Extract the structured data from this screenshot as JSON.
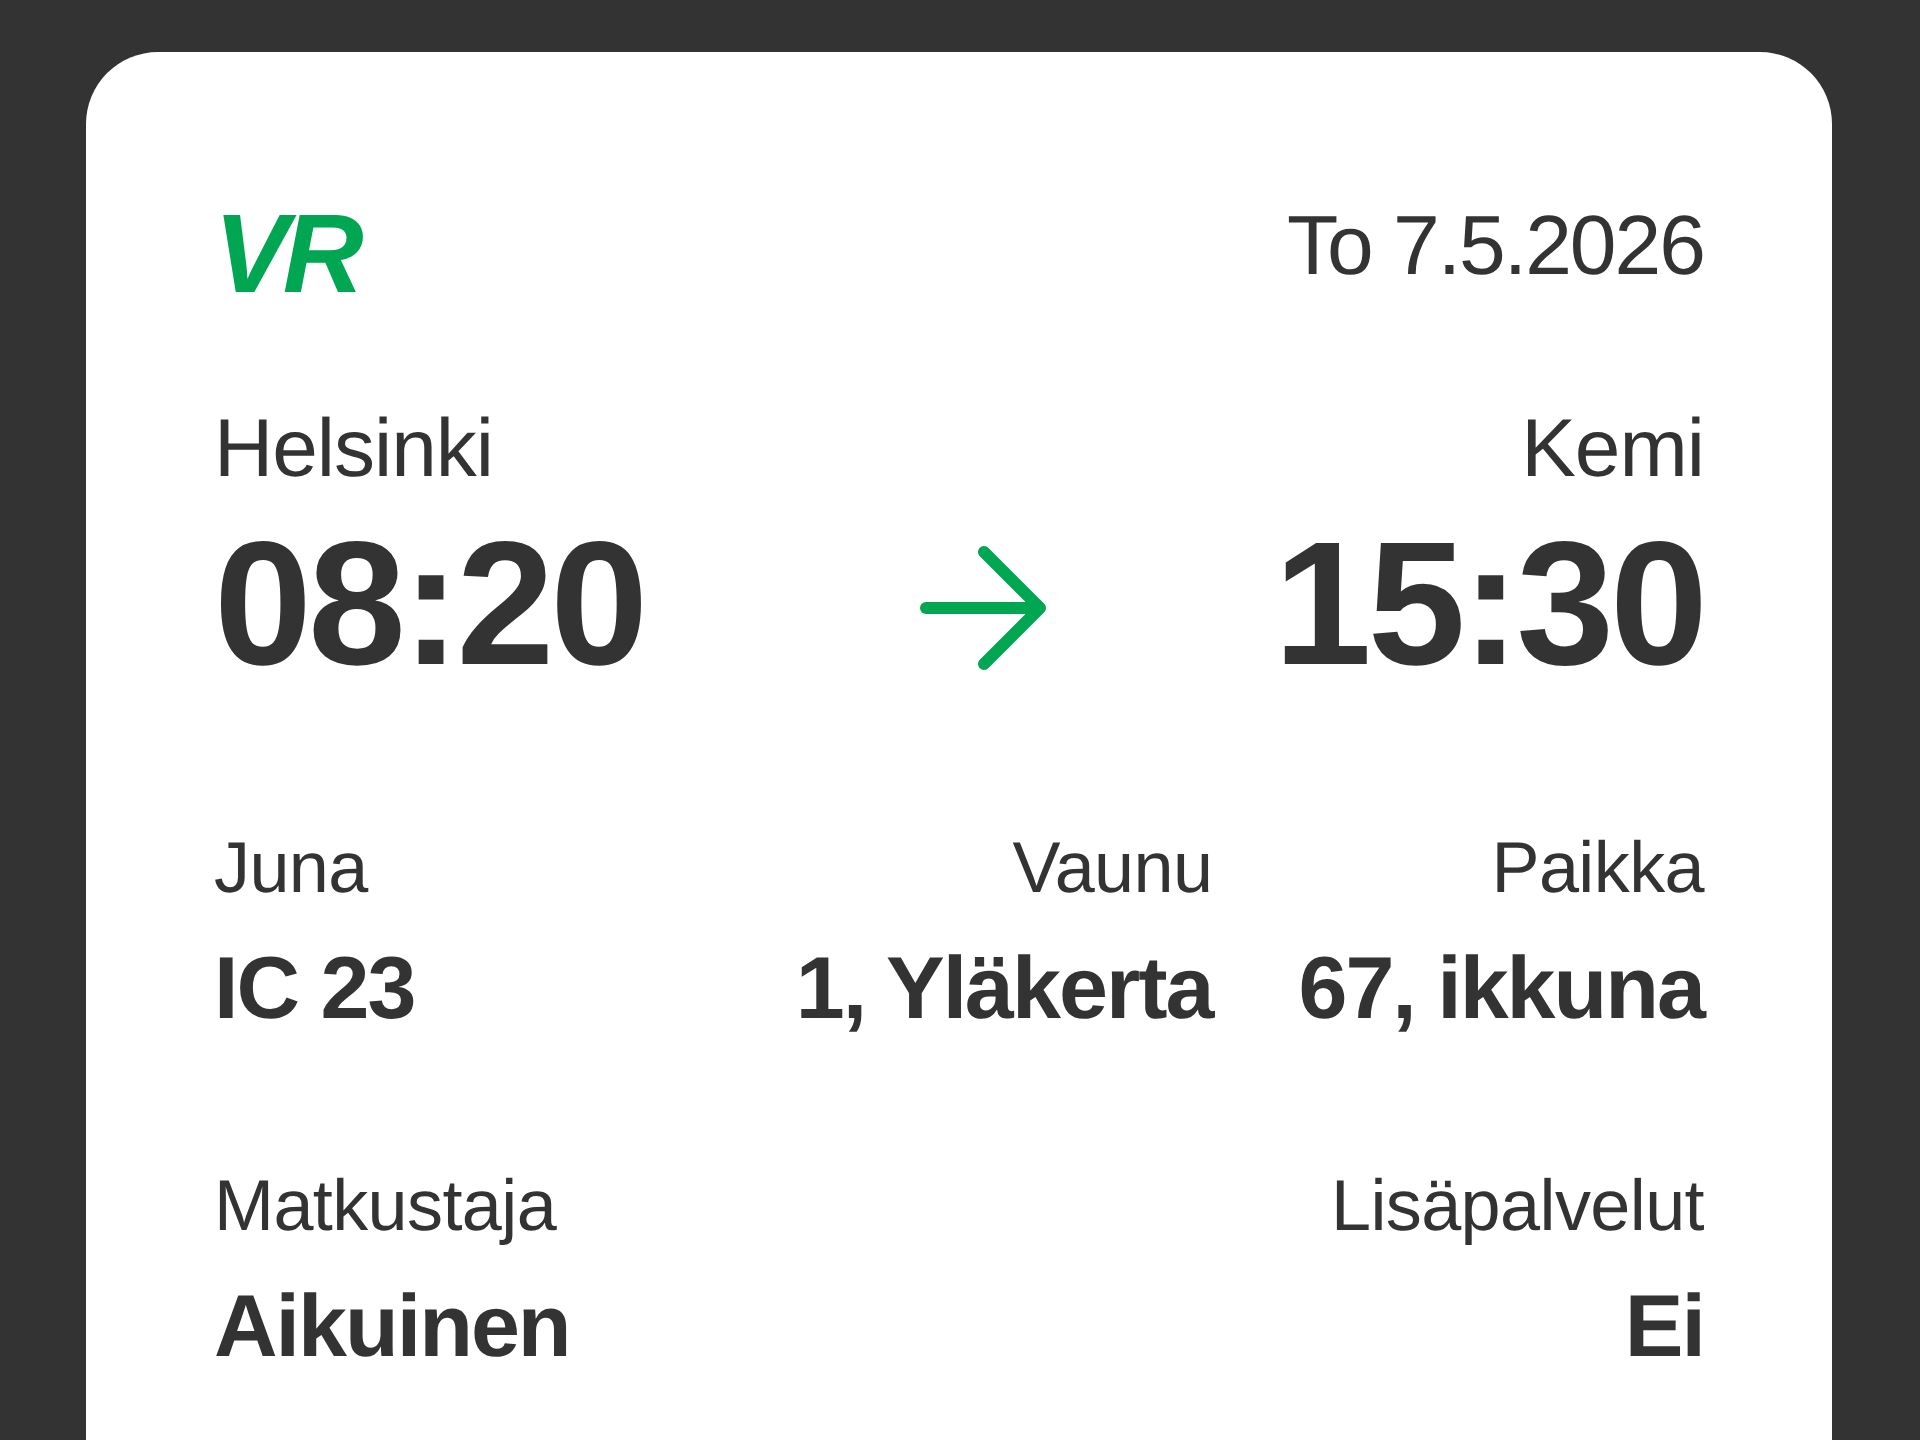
{
  "header": {
    "logo": "VR",
    "date": "To 7.5.2026"
  },
  "route": {
    "departure": {
      "station": "Helsinki",
      "time": "08:20"
    },
    "arrival": {
      "station": "Kemi",
      "time": "15:30"
    }
  },
  "details": [
    {
      "label": "Juna",
      "value": "IC 23"
    },
    {
      "label": "Vaunu",
      "value": "1, Yläkerta"
    },
    {
      "label": "Paikka",
      "value": "67, ikkuna"
    }
  ],
  "passenger": [
    {
      "label": "Matkustaja",
      "value": "Aikuinen"
    },
    {
      "label": "Lisäpalvelut",
      "value": "Ei"
    }
  ]
}
